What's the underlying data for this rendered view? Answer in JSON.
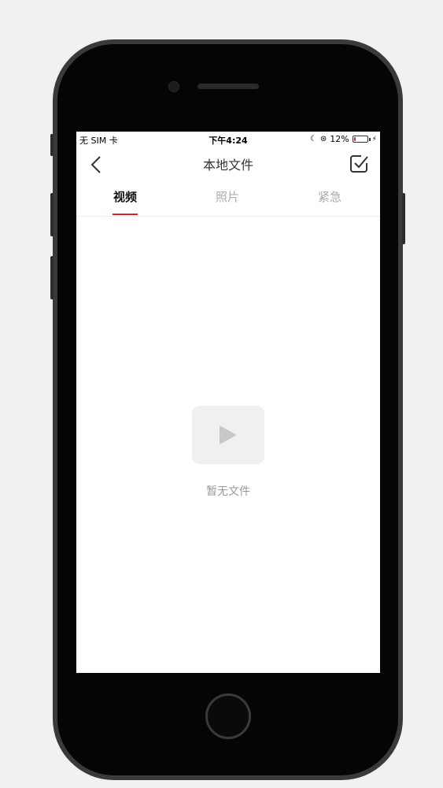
{
  "status_bar": {
    "carrier": "无 SIM 卡",
    "time": "下午4:24",
    "battery_percent": "12%",
    "battery_level": 0.12
  },
  "nav": {
    "title": "本地文件",
    "back_icon": "chevron-left-icon",
    "select_icon": "checkbox-square-icon"
  },
  "tabs": [
    {
      "label": "视频",
      "active": true
    },
    {
      "label": "照片",
      "active": false
    },
    {
      "label": "紧急",
      "active": false
    }
  ],
  "empty_state": {
    "icon": "video-play-icon",
    "text": "暂无文件"
  },
  "colors": {
    "accent": "#d0252b",
    "tab_inactive": "#aaaaaa",
    "empty_text": "#999999"
  }
}
